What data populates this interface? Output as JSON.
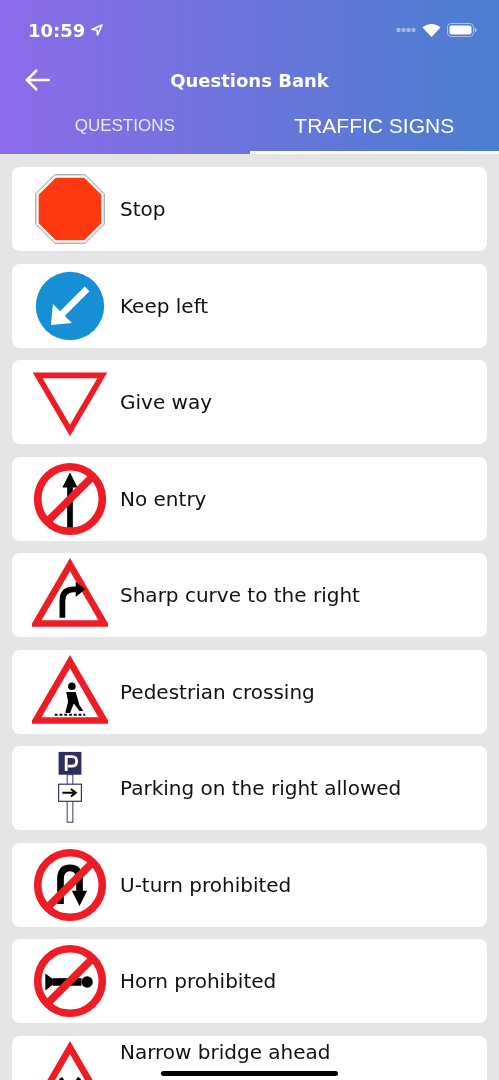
{
  "status_bar": {
    "time": "10:59"
  },
  "header": {
    "title": "Questions Bank"
  },
  "tabs": [
    {
      "label": "QUESTIONS",
      "selected": false
    },
    {
      "label": "TRAFFIC SIGNS",
      "selected": true
    }
  ],
  "signs": [
    {
      "kind": "stop",
      "label": "Stop"
    },
    {
      "kind": "keep-left",
      "label": "Keep left"
    },
    {
      "kind": "give-way",
      "label": "Give way"
    },
    {
      "kind": "no-entry",
      "label": "No entry"
    },
    {
      "kind": "curve-right",
      "label": "Sharp curve to the right"
    },
    {
      "kind": "pedestrian",
      "label": "Pedestrian crossing"
    },
    {
      "kind": "parking-right",
      "label": "Parking on the right allowed"
    },
    {
      "kind": "no-u-turn",
      "label": "U-turn prohibited"
    },
    {
      "kind": "no-horn",
      "label": "Horn prohibited"
    },
    {
      "kind": "narrow-bridge",
      "label": "Narrow bridge ahead"
    }
  ]
}
